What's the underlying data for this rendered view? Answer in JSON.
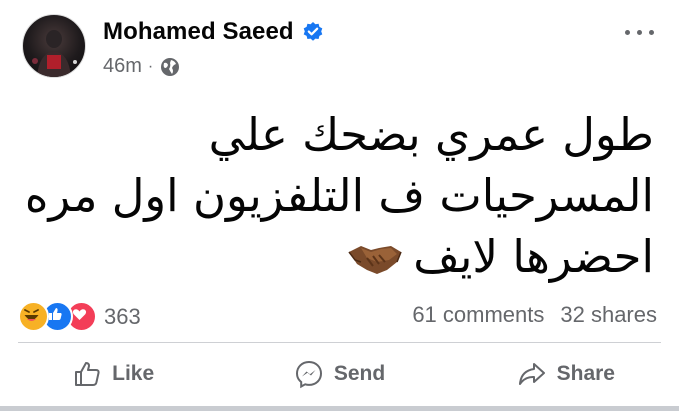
{
  "post": {
    "author": "Mohamed Saeed",
    "time": "46m",
    "separator": "·",
    "text_lines": [
      "طول عمري بضحك علي",
      "المسرحيات ف التلفزيون اول مره",
      "احضرها لايف"
    ]
  },
  "engagement": {
    "reaction_count": "363",
    "comments": "61 comments",
    "shares": "32 shares"
  },
  "actions": {
    "like": "Like",
    "send": "Send",
    "share": "Share"
  },
  "colors": {
    "verified": "#1877f2",
    "secondary_text": "#65676b",
    "like_reaction": "#1877f2",
    "love_reaction": "#f33e58",
    "haha_reaction": "#f7b125"
  }
}
